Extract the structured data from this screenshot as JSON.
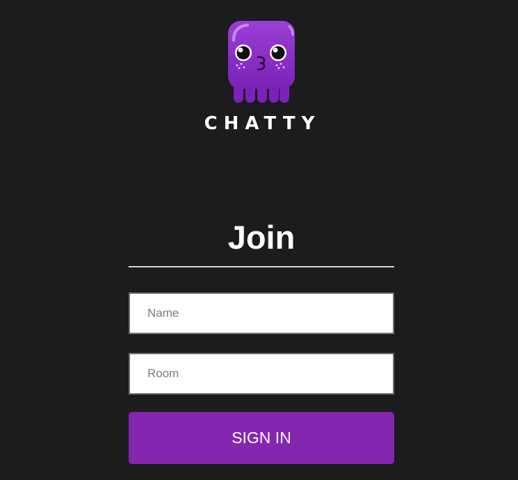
{
  "brand": {
    "logo_icon": "purple-octopus-mascot",
    "name": "CHATTY"
  },
  "form": {
    "title": "Join",
    "name_placeholder": "Name",
    "name_value": "",
    "room_placeholder": "Room",
    "room_value": "",
    "submit_label": "SIGN IN"
  },
  "colors": {
    "background": "#1c1b1d",
    "accent": "#8426b0",
    "mascot": "#8b2fc9"
  }
}
